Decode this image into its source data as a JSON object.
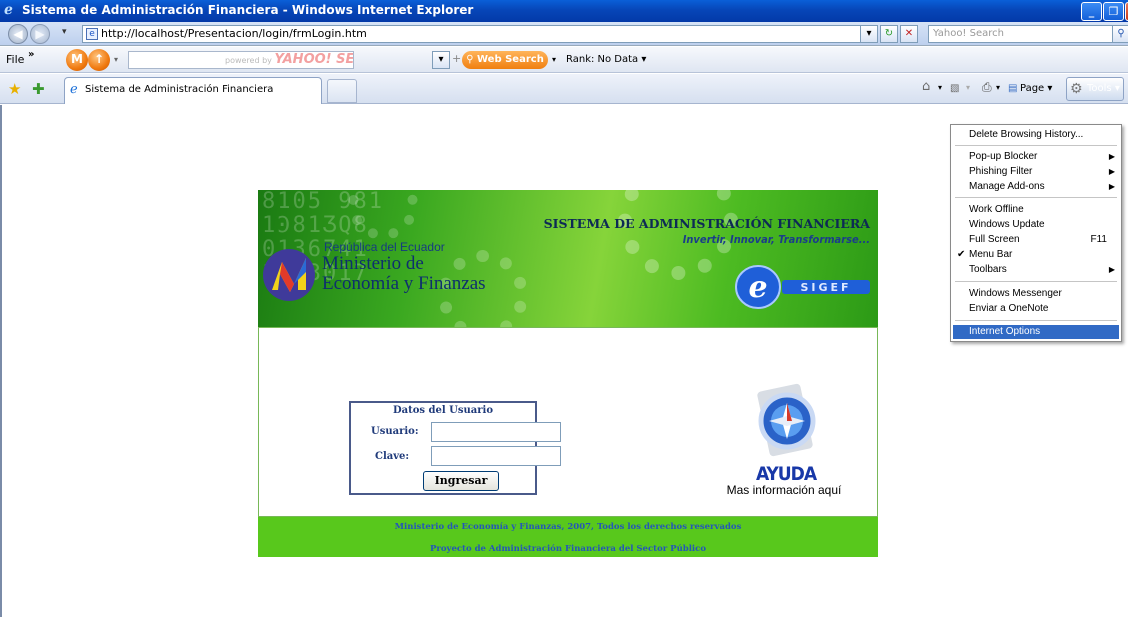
{
  "window": {
    "title": "Sistema de Administración Financiera - Windows Internet Explorer",
    "min_label": "_",
    "max_label": "❐",
    "close_label": "✕"
  },
  "address": {
    "url": "http://localhost/Presentacion/login/frmLogin.htm",
    "search_placeholder": "Yahoo! Search"
  },
  "yahoo_toolbar": {
    "file_label": "File",
    "powered_by": "powered by",
    "yahoo_logo": "YAHOO! SEARCH",
    "web_search_label": "Web Search",
    "rank_label": "Rank: No Data ▾",
    "ball_labels": [
      "M",
      "↑"
    ]
  },
  "tabs": [
    {
      "label": "Sistema de Administración Financiera"
    }
  ],
  "command_bar": {
    "page_label": "Page ▾",
    "tools_label": "Tools ▾"
  },
  "page": {
    "system_name": "SISTEMA DE ADMINISTRACIÓN FINANCIERA",
    "slogan": "Invertir, Innovar, Transformarse...",
    "republic": "República del Ecuador",
    "ministry_line1": "Ministerio de",
    "ministry_line2": "Economía y Finanzas",
    "sigef_text": "SIGEF",
    "login": {
      "heading": "Datos del Usuario",
      "user_label": "Usuario:",
      "password_label": "Clave:",
      "user_value": "",
      "password_value": "",
      "submit_label": "Ingresar"
    },
    "help": {
      "title": "AYUDA",
      "subtitle": "Mas información aquí"
    },
    "footer_line1": "Ministerio de Economía y Finanzas, 2007, Todos los derechos reservados",
    "footer_line2": "Proyecto de Administración Financiera del Sector Público"
  },
  "tools_menu": {
    "items": [
      {
        "label": "Delete Browsing History...",
        "shortcut": "",
        "submenu": false,
        "checked": false
      },
      {
        "label": "Pop-up Blocker",
        "shortcut": "",
        "submenu": true,
        "checked": false
      },
      {
        "label": "Phishing Filter",
        "shortcut": "",
        "submenu": true,
        "checked": false
      },
      {
        "label": "Manage Add-ons",
        "shortcut": "",
        "submenu": true,
        "checked": false
      },
      {
        "label": "Work Offline",
        "shortcut": "",
        "submenu": false,
        "checked": false
      },
      {
        "label": "Windows Update",
        "shortcut": "",
        "submenu": false,
        "checked": false
      },
      {
        "label": "Full Screen",
        "shortcut": "F11",
        "submenu": false,
        "checked": false
      },
      {
        "label": "Menu Bar",
        "shortcut": "",
        "submenu": false,
        "checked": true
      },
      {
        "label": "Toolbars",
        "shortcut": "",
        "submenu": true,
        "checked": false
      },
      {
        "label": "Windows Messenger",
        "shortcut": "",
        "submenu": false,
        "checked": false
      },
      {
        "label": "Enviar a OneNote",
        "shortcut": "",
        "submenu": false,
        "checked": false
      },
      {
        "label": "Internet Options",
        "shortcut": "",
        "submenu": false,
        "checked": false,
        "highlighted": true
      }
    ]
  },
  "colors": {
    "titlebar": "#0746b8",
    "banner_green": "#3aa820",
    "footer_green": "#58c81c",
    "menu_highlight": "#316ac5"
  }
}
